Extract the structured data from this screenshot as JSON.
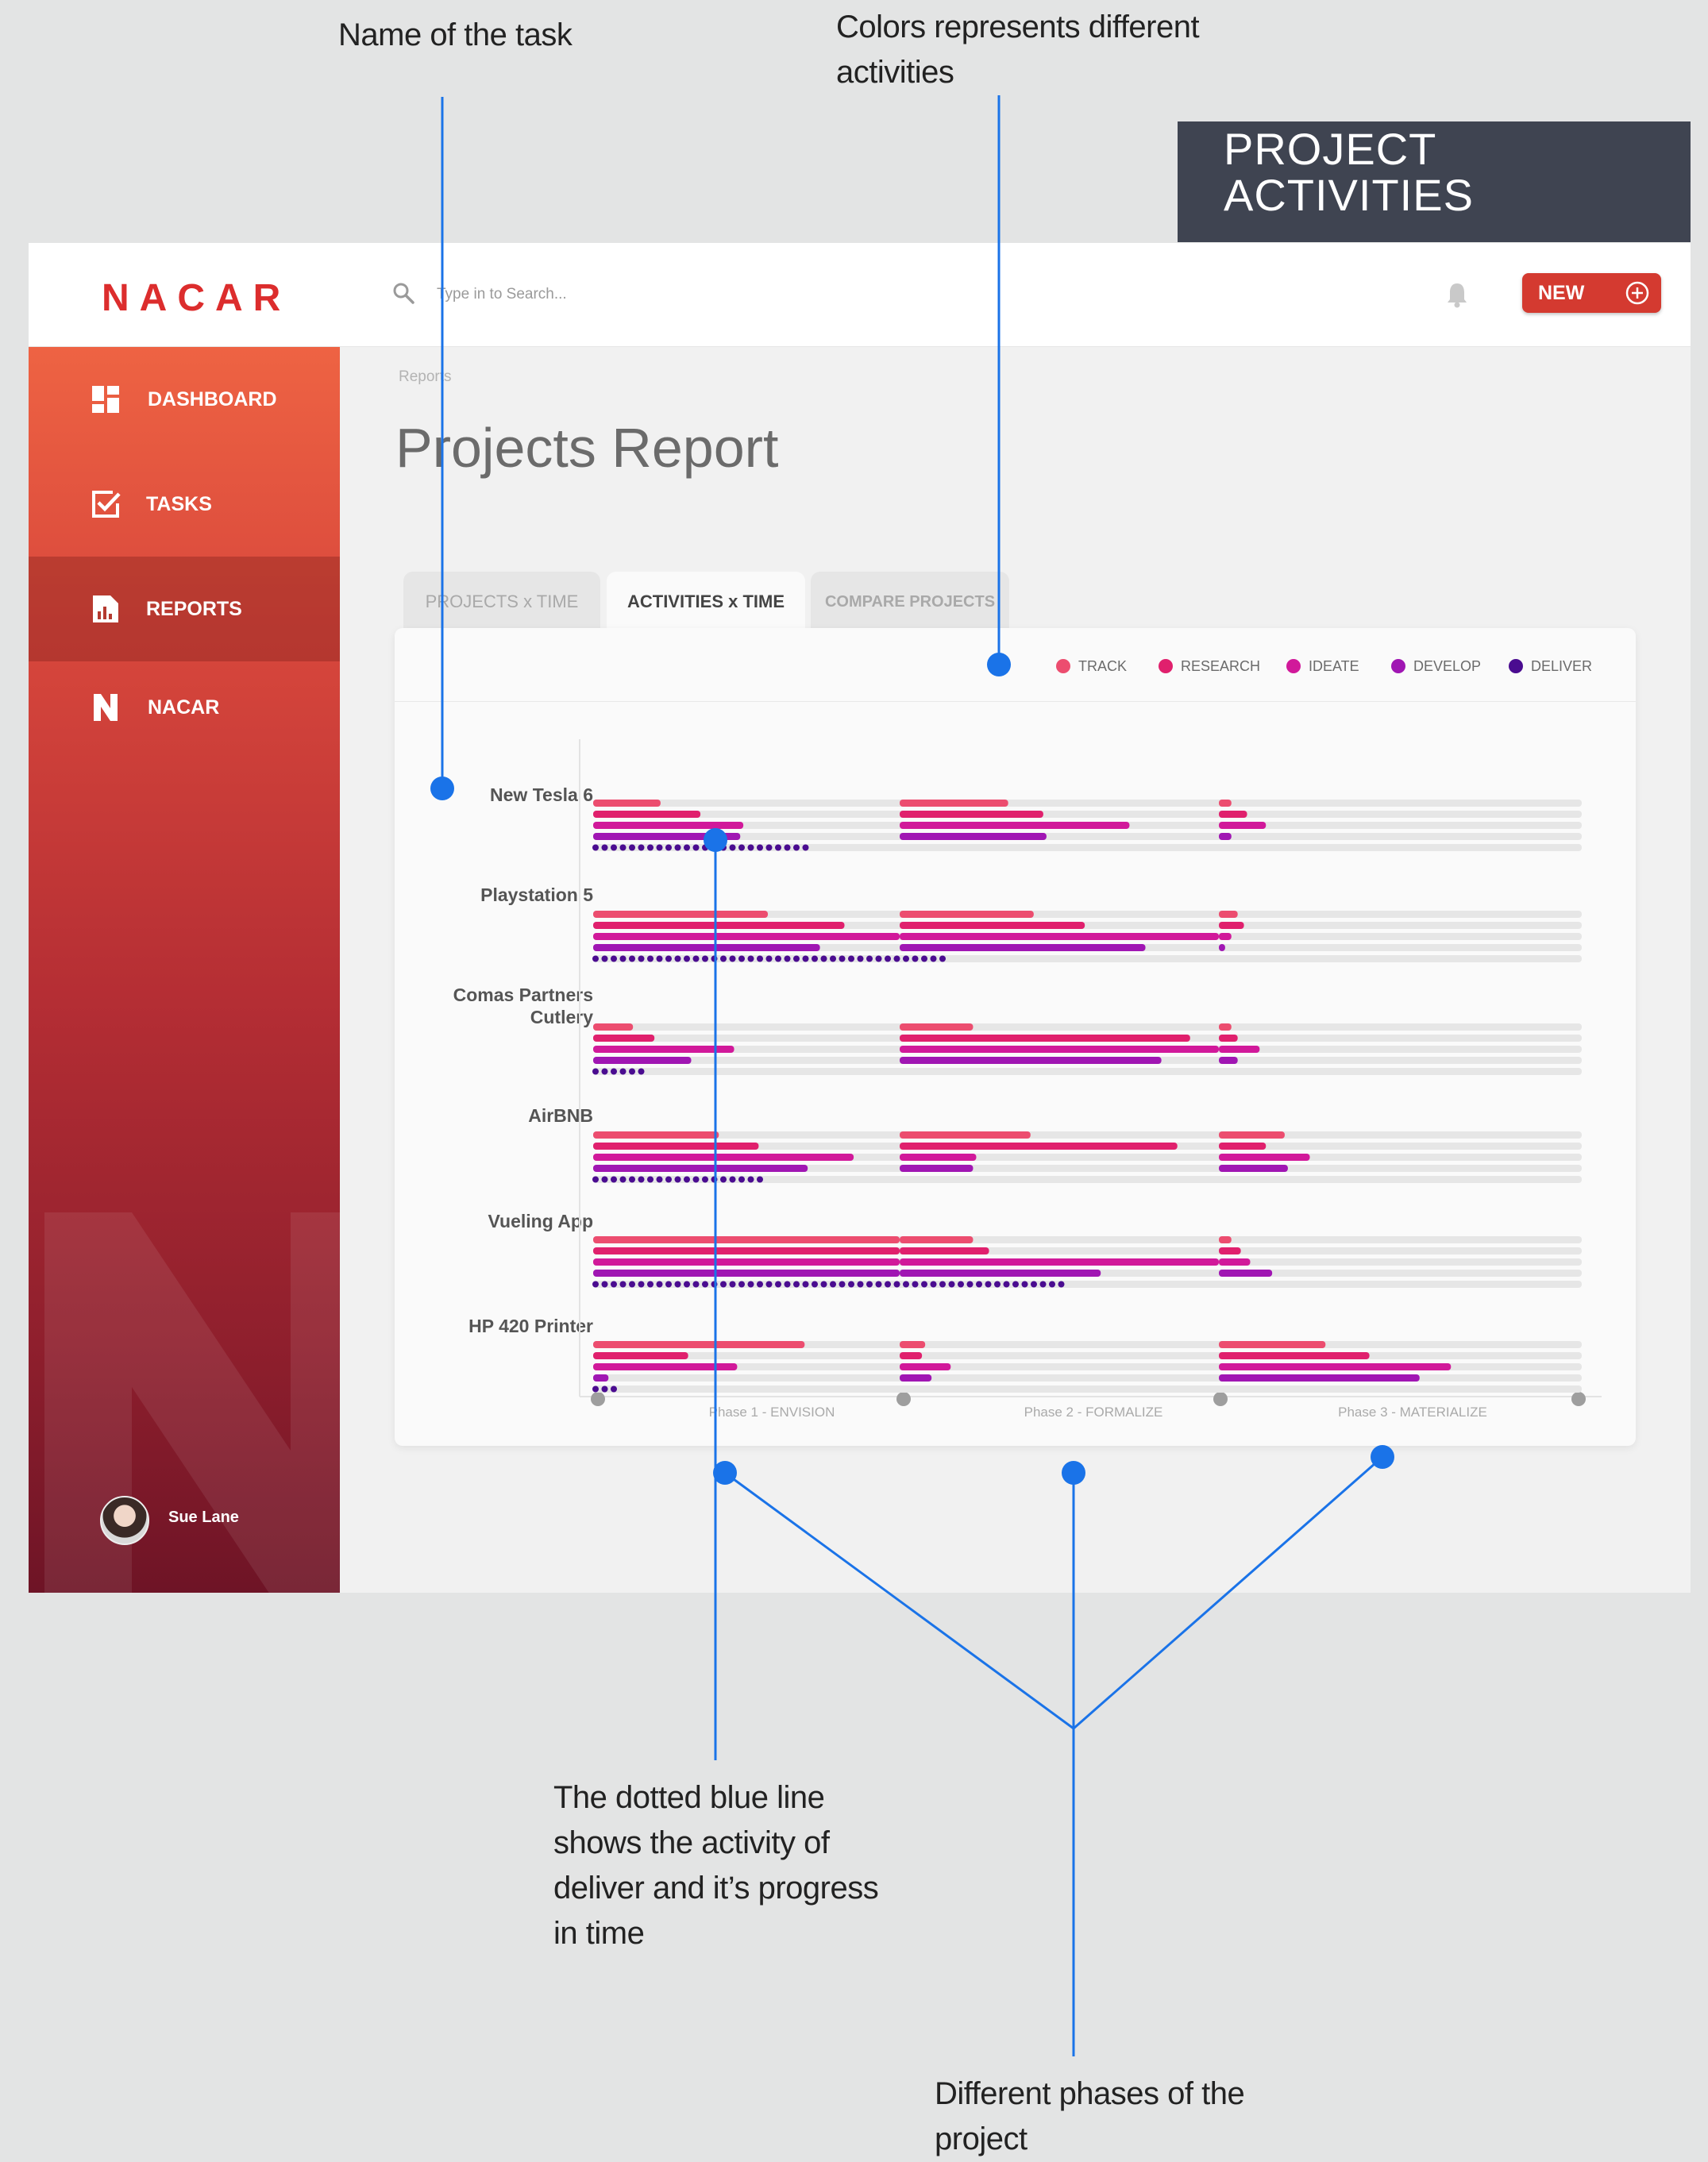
{
  "annotations": {
    "task_name": "Name of the task",
    "colors_line1": "Colors represents different",
    "colors_line2": "activities",
    "deliver_lines": [
      "The dotted blue line",
      "shows the activity of",
      "deliver and it’s progress",
      "in time"
    ],
    "phases_lines": [
      "Different phases of the",
      "project"
    ]
  },
  "title_box": {
    "line1": "PROJECT",
    "line2": "ACTIVITIES"
  },
  "app": {
    "logo": "NACAR",
    "search": {
      "placeholder": "Type in to Search..."
    },
    "new_button": "NEW",
    "sidebar": [
      {
        "label": "DASHBOARD",
        "icon": "dashboard-icon"
      },
      {
        "label": "TASKS",
        "icon": "tasks-icon"
      },
      {
        "label": "REPORTS",
        "icon": "reports-icon"
      },
      {
        "label": "NACAR",
        "icon": "nacar-logo-icon"
      }
    ],
    "active_nav": "REPORTS",
    "user": {
      "name": "Sue Lane"
    },
    "breadcrumb": "Reports",
    "page_title": "Projects Report",
    "tabs": [
      "PROJECTS x TIME",
      "ACTIVITIES x TIME",
      "COMPARE PROJECTS"
    ],
    "active_tab": "ACTIVITIES x TIME"
  },
  "colors": {
    "track": "#ec4d6f",
    "research": "#e0206d",
    "ideate": "#d1199a",
    "develop": "#a016b3",
    "deliver": "#4a0c90",
    "annotation": "#1a73e8",
    "bar_background": "#e6e6e6"
  },
  "chart_data": {
    "type": "bar",
    "activities": [
      "TRACK",
      "RESEARCH",
      "IDEATE",
      "DEVELOP",
      "DELIVER"
    ],
    "phases": [
      "Phase 1 - ENVISION",
      "Phase 2 - FORMALIZE",
      "Phase 3 - MATERIALIZE"
    ],
    "projects": [
      {
        "name": "New Tesla 6",
        "phases": [
          [
            0.22,
            0.35,
            0.49,
            0.48
          ],
          [
            0.34,
            0.45,
            0.72,
            0.46
          ],
          [
            0.04,
            0.09,
            0.15,
            0.04
          ]
        ],
        "deliver": 0.72
      },
      {
        "name": "Playstation 5",
        "phases": [
          [
            0.57,
            0.82,
            1.0,
            0.74
          ],
          [
            0.42,
            0.58,
            1.0,
            0.77
          ],
          [
            0.06,
            0.08,
            0.04,
            0.02
          ]
        ],
        "deliver": 1.17
      },
      {
        "name": "Comas Partners\nCutlery",
        "phases": [
          [
            0.13,
            0.2,
            0.46,
            0.32
          ],
          [
            0.23,
            0.91,
            1.0,
            0.82
          ],
          [
            0.04,
            0.06,
            0.13,
            0.06
          ]
        ],
        "deliver": 0.17
      },
      {
        "name": "AirBNB",
        "phases": [
          [
            0.41,
            0.54,
            0.85,
            0.7
          ],
          [
            0.41,
            0.87,
            0.24,
            0.23
          ],
          [
            0.21,
            0.15,
            0.29,
            0.22
          ]
        ],
        "deliver": 0.56
      },
      {
        "name": "Vueling App",
        "phases": [
          [
            1.0,
            1.0,
            1.0,
            1.0
          ],
          [
            0.23,
            0.28,
            1.0,
            0.63
          ],
          [
            0.04,
            0.07,
            0.1,
            0.17
          ]
        ],
        "deliver": 1.56
      },
      {
        "name": "HP 420 Printer",
        "phases": [
          [
            0.69,
            0.31,
            0.47,
            0.05
          ],
          [
            0.08,
            0.07,
            0.16,
            0.1
          ],
          [
            0.34,
            0.48,
            0.74,
            0.64
          ]
        ],
        "deliver": 0.08
      }
    ]
  }
}
